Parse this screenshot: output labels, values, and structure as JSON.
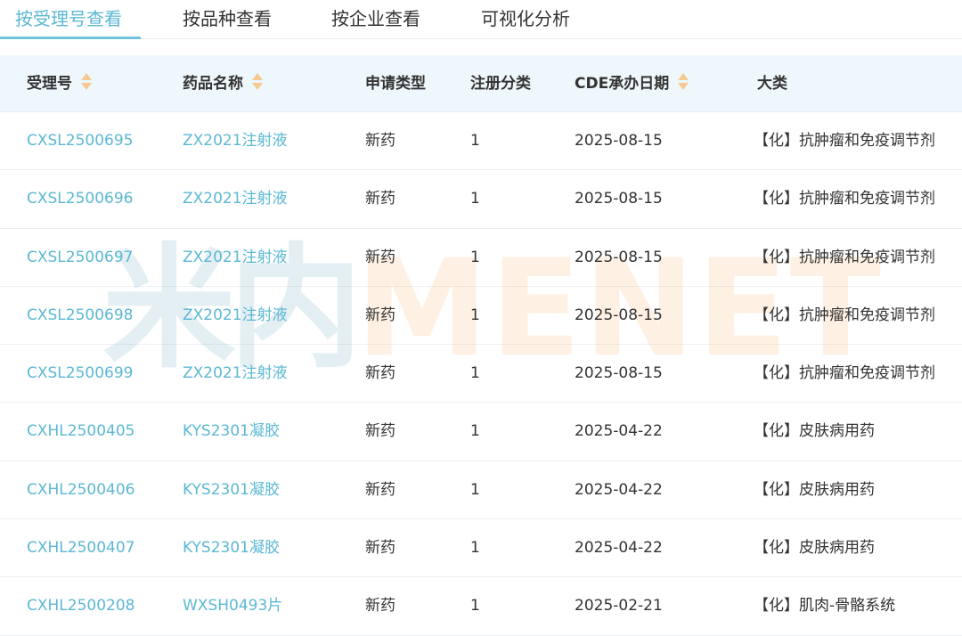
{
  "tabs": [
    {
      "label": "按受理号查看",
      "active": true
    },
    {
      "label": "按品种查看",
      "active": false
    },
    {
      "label": "按企业查看",
      "active": false
    },
    {
      "label": "可视化分析",
      "active": false
    }
  ],
  "watermark": {
    "cn": "米内",
    "en": "MENET"
  },
  "table": {
    "columns": [
      {
        "label": "受理号",
        "sortable": true
      },
      {
        "label": "药品名称",
        "sortable": true
      },
      {
        "label": "申请类型",
        "sortable": false
      },
      {
        "label": "注册分类",
        "sortable": false
      },
      {
        "label": "CDE承办日期",
        "sortable": true
      },
      {
        "label": "大类",
        "sortable": false
      }
    ],
    "rows": [
      [
        "CXSL2500695",
        "ZX2021注射液",
        "新药",
        "1",
        "2025-08-15",
        "【化】抗肿瘤和免疫调节剂"
      ],
      [
        "CXSL2500696",
        "ZX2021注射液",
        "新药",
        "1",
        "2025-08-15",
        "【化】抗肿瘤和免疫调节剂"
      ],
      [
        "CXSL2500697",
        "ZX2021注射液",
        "新药",
        "1",
        "2025-08-15",
        "【化】抗肿瘤和免疫调节剂"
      ],
      [
        "CXSL2500698",
        "ZX2021注射液",
        "新药",
        "1",
        "2025-08-15",
        "【化】抗肿瘤和免疫调节剂"
      ],
      [
        "CXSL2500699",
        "ZX2021注射液",
        "新药",
        "1",
        "2025-08-15",
        "【化】抗肿瘤和免疫调节剂"
      ],
      [
        "CXHL2500405",
        "KYS2301凝胶",
        "新药",
        "1",
        "2025-04-22",
        "【化】皮肤病用药"
      ],
      [
        "CXHL2500406",
        "KYS2301凝胶",
        "新药",
        "1",
        "2025-04-22",
        "【化】皮肤病用药"
      ],
      [
        "CXHL2500407",
        "KYS2301凝胶",
        "新药",
        "1",
        "2025-04-22",
        "【化】皮肤病用药"
      ],
      [
        "CXHL2500208",
        "WXSH0493片",
        "新药",
        "1",
        "2025-02-21",
        "【化】肌肉-骨骼系统"
      ]
    ]
  },
  "colors": {
    "accent": "#5bb8d3",
    "header_bg": "#eef7fb",
    "sort_icon": "#f6c892"
  }
}
